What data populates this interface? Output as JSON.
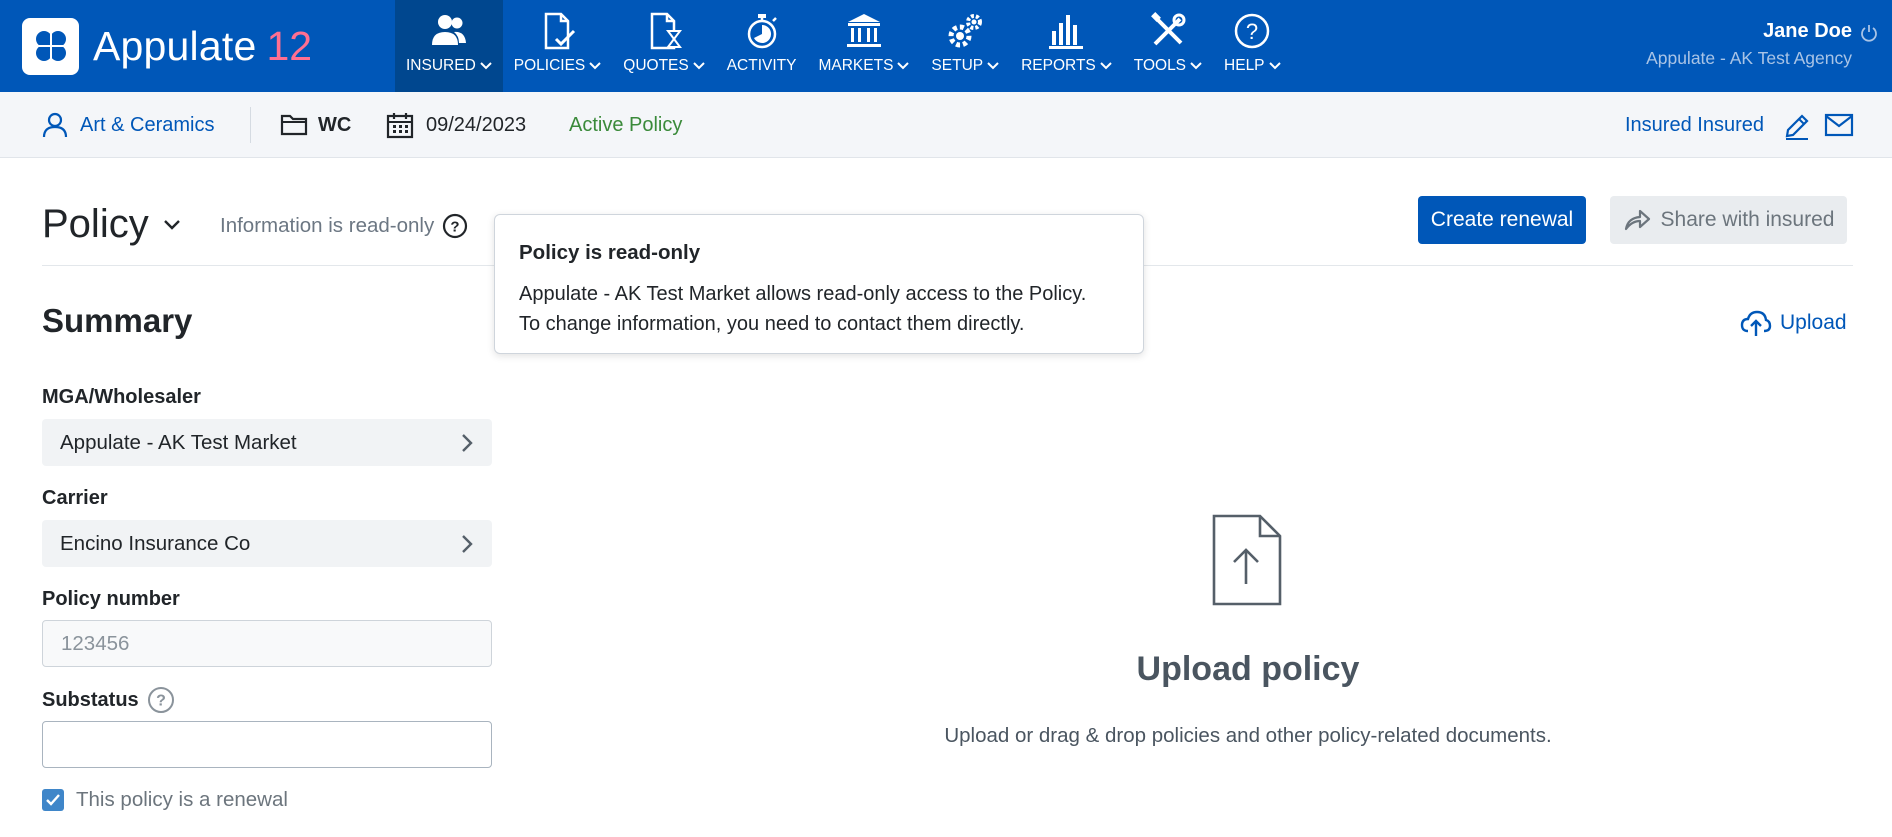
{
  "app": {
    "name": "Appulate",
    "version": "12",
    "brand_color": "#0057b8",
    "accent_color": "#ff6f91"
  },
  "nav": {
    "items": [
      {
        "label": "INSURED",
        "icon": "users-icon",
        "active": true,
        "dropdown": true
      },
      {
        "label": "POLICIES",
        "icon": "policy-doc-icon",
        "active": false,
        "dropdown": true
      },
      {
        "label": "QUOTES",
        "icon": "quote-hourglass-icon",
        "active": false,
        "dropdown": true
      },
      {
        "label": "ACTIVITY",
        "icon": "stopwatch-icon",
        "active": false,
        "dropdown": false
      },
      {
        "label": "MARKETS",
        "icon": "bank-icon",
        "active": false,
        "dropdown": true
      },
      {
        "label": "SETUP",
        "icon": "gears-icon",
        "active": false,
        "dropdown": true
      },
      {
        "label": "REPORTS",
        "icon": "bar-chart-icon",
        "active": false,
        "dropdown": true
      },
      {
        "label": "TOOLS",
        "icon": "tools-icon",
        "active": false,
        "dropdown": true
      },
      {
        "label": "HELP",
        "icon": "help-icon",
        "active": false,
        "dropdown": true
      }
    ]
  },
  "user": {
    "name": "Jane Doe",
    "agency": "Appulate - AK Test Agency"
  },
  "context": {
    "insured_name": "Art & Ceramics",
    "line": "WC",
    "date": "09/24/2023",
    "status": "Active Policy",
    "contact": "Insured Insured"
  },
  "page": {
    "title": "Policy",
    "readonly_note": "Information is read-only",
    "create_renewal": "Create renewal",
    "share": "Share with insured"
  },
  "tooltip": {
    "title": "Policy is read-only",
    "line1": "Appulate - AK Test Market allows read-only access to the Policy.",
    "line2": "To change information, you need to contact them directly."
  },
  "summary": {
    "title": "Summary",
    "mga_label": "MGA/Wholesaler",
    "mga_value": "Appulate - AK Test Market",
    "carrier_label": "Carrier",
    "carrier_value": "Encino Insurance Co",
    "policy_number_label": "Policy number",
    "policy_number_placeholder": "123456",
    "substatus_label": "Substatus",
    "substatus_value": "",
    "renewal_label": "This policy is a renewal",
    "renewal_checked": true
  },
  "upload": {
    "link": "Upload",
    "title": "Upload policy",
    "description": "Upload or drag & drop policies and other policy-related documents."
  }
}
